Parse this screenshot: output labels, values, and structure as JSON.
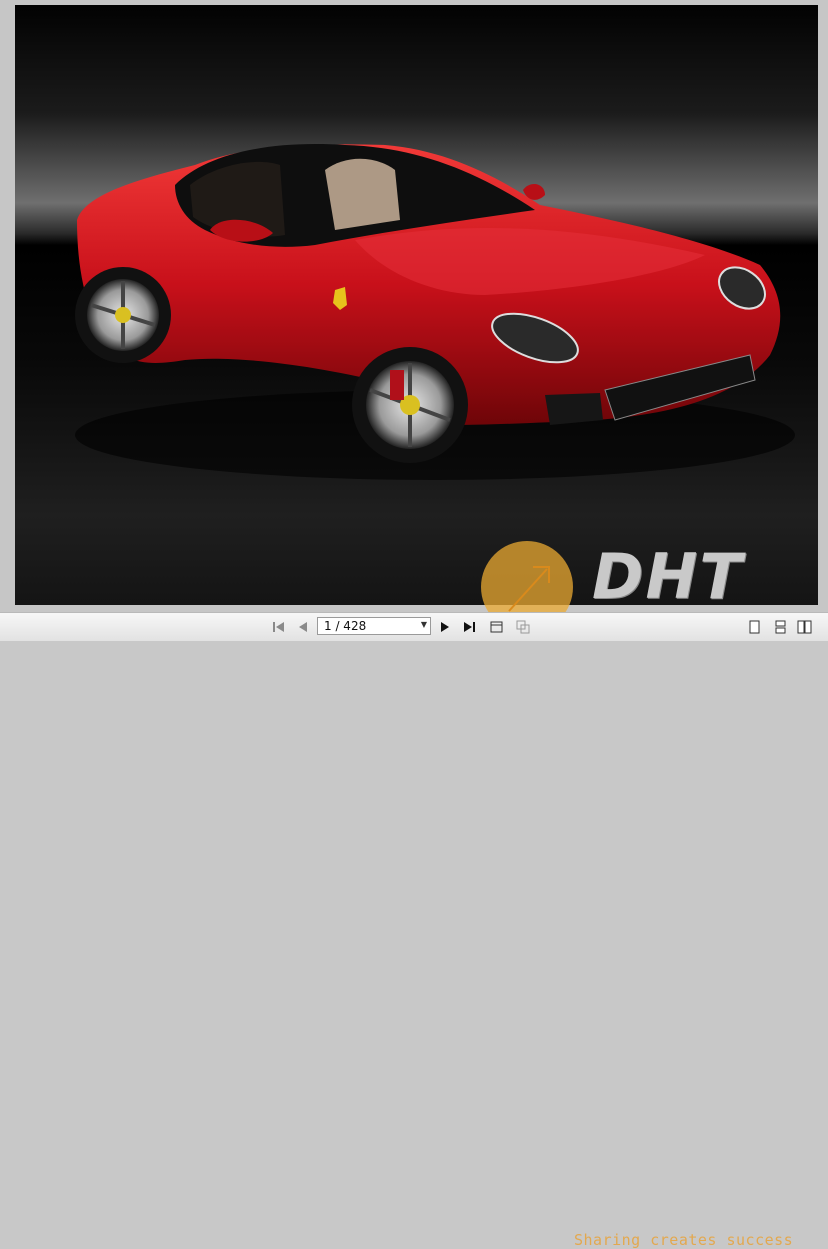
{
  "viewer": {
    "page_indicator": "1 / 428",
    "icons": {
      "first": "first-page-icon",
      "prev": "previous-page-icon",
      "next": "next-page-icon",
      "last": "last-page-icon",
      "fit": "fit-page-icon",
      "thumbs": "thumbnails-icon",
      "single": "single-page-view-icon",
      "continuous": "continuous-view-icon",
      "facing": "facing-pages-icon"
    }
  },
  "watermark": {
    "logo": "DHT",
    "tagline": "Sharing creates success"
  },
  "colors": {
    "car_red": "#d01018",
    "watermark_orange": "#e8a33a"
  }
}
